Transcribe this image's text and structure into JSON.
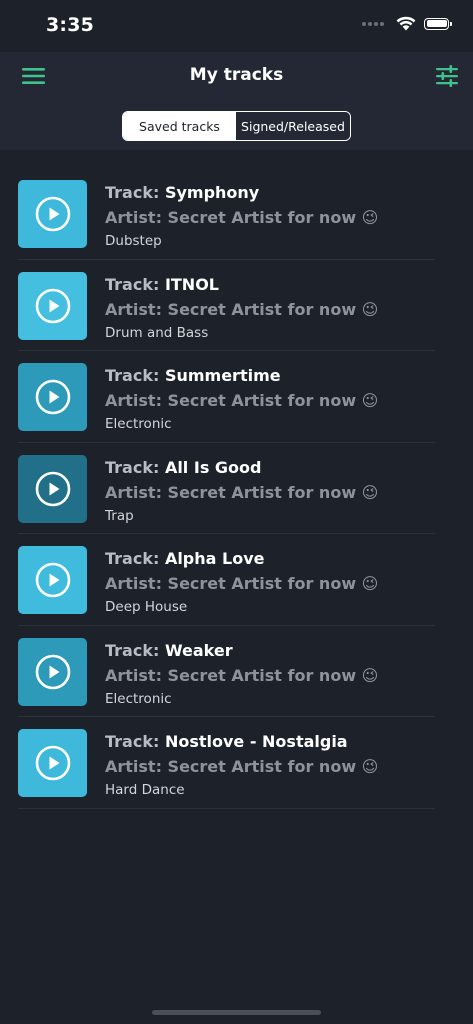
{
  "status_bar": {
    "time": "3:35",
    "icons": [
      "cellular-dots-icon",
      "wifi-icon",
      "battery-icon"
    ]
  },
  "header": {
    "title": "My tracks",
    "menu_icon": "hamburger-menu-icon",
    "filter_icon": "sliders-filter-icon",
    "accent_color": "#3fc38a"
  },
  "tabs": {
    "saved": "Saved tracks",
    "signed": "Signed/Released",
    "selected": "saved"
  },
  "labels": {
    "track_prefix": "Track: ",
    "play_icon": "play-circle-icon"
  },
  "tracks": [
    {
      "title": "Symphony",
      "artist": "Artist: Secret Artist for now 😉",
      "genre": "Dubstep",
      "color": "#3eb9dc"
    },
    {
      "title": "ITNOL",
      "artist": "Artist: Secret Artist for now 😉",
      "genre": "Drum and Bass",
      "color": "#45bfe0"
    },
    {
      "title": "Summertime",
      "artist": "Artist: Secret Artist for now 😉",
      "genre": "Electronic",
      "color": "#2d9ab9"
    },
    {
      "title": "All Is Good",
      "artist": "Artist: Secret Artist for now 😉",
      "genre": "Trap",
      "color": "#216f89"
    },
    {
      "title": "Alpha Love",
      "artist": "Artist: Secret Artist for now 😉",
      "genre": "Deep House",
      "color": "#3fbbde"
    },
    {
      "title": "Weaker",
      "artist": "Artist: Secret Artist for now 😉",
      "genre": "Electronic",
      "color": "#2d9ab9"
    },
    {
      "title": "Nostlove - Nostalgia",
      "artist": "Artist: Secret Artist for now 😉",
      "genre": "Hard Dance",
      "color": "#3eb9dc"
    }
  ]
}
